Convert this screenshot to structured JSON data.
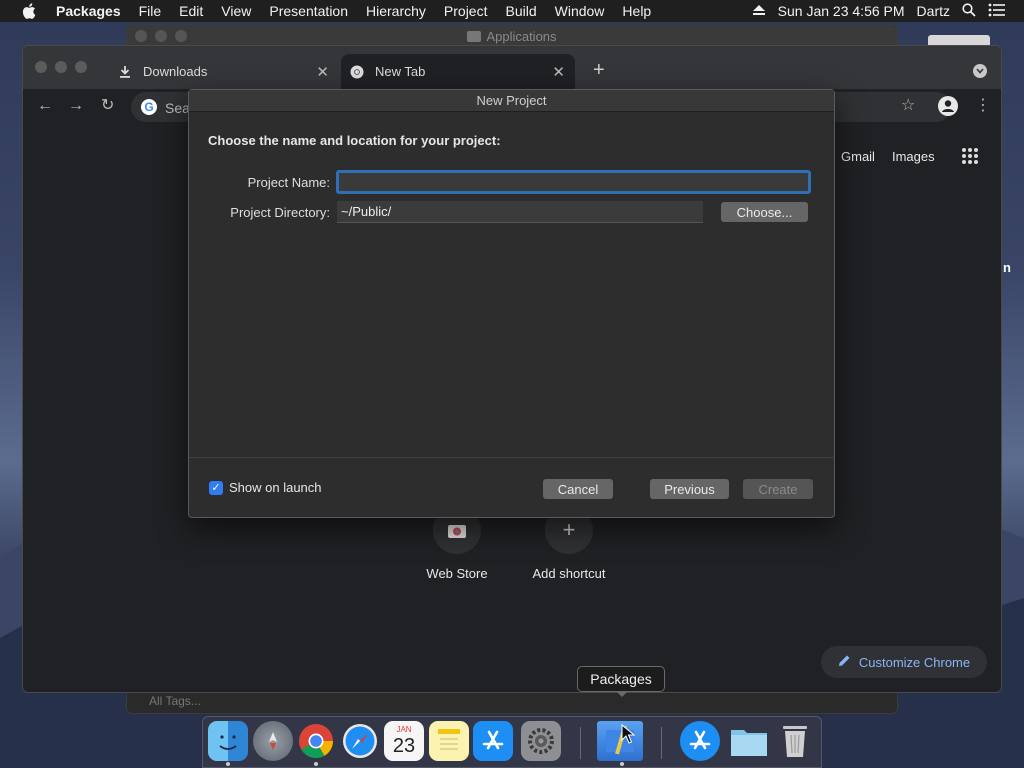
{
  "menubar": {
    "app_name": "Packages",
    "items": [
      "File",
      "Edit",
      "View",
      "Presentation",
      "Hierarchy",
      "Project",
      "Build",
      "Window",
      "Help"
    ],
    "clock": "Sun Jan 23  4:56 PM",
    "user": "Dartz"
  },
  "finder_window": {
    "title": "Applications",
    "footer": "All Tags..."
  },
  "chrome": {
    "tabs": [
      {
        "label": "Downloads",
        "icon": "download-icon"
      },
      {
        "label": "New Tab",
        "icon": "chrome-icon"
      }
    ],
    "omnibox_placeholder": "Sea",
    "ntp_links": [
      "Gmail",
      "Images"
    ],
    "shortcuts": [
      {
        "label": "Web Store",
        "icon": "web-store-icon"
      },
      {
        "label": "Add shortcut",
        "icon": "plus-icon"
      }
    ],
    "customize_label": "Customize Chrome",
    "clipped_right_text": "n"
  },
  "dialog": {
    "title": "New Project",
    "heading": "Choose the name and location for your project:",
    "project_name_label": "Project Name:",
    "project_name_value": "",
    "project_directory_label": "Project Directory:",
    "project_directory_value": "~/Public/",
    "choose_label": "Choose...",
    "show_on_launch_label": "Show on launch",
    "show_on_launch_checked": true,
    "cancel_label": "Cancel",
    "previous_label": "Previous",
    "create_label": "Create"
  },
  "dock": {
    "tooltip": "Packages",
    "apps": [
      "Finder",
      "Launchpad",
      "Google Chrome",
      "Safari",
      "Calendar",
      "Notes",
      "App Store",
      "System Preferences",
      "Packages",
      "App Store",
      "Downloads",
      "Trash"
    ],
    "calendar_month": "JAN",
    "calendar_day": "23"
  },
  "colors": {
    "accent": "#2f7cf6",
    "focus_ring": "#2e6fb5",
    "link": "#8ab4f8"
  }
}
